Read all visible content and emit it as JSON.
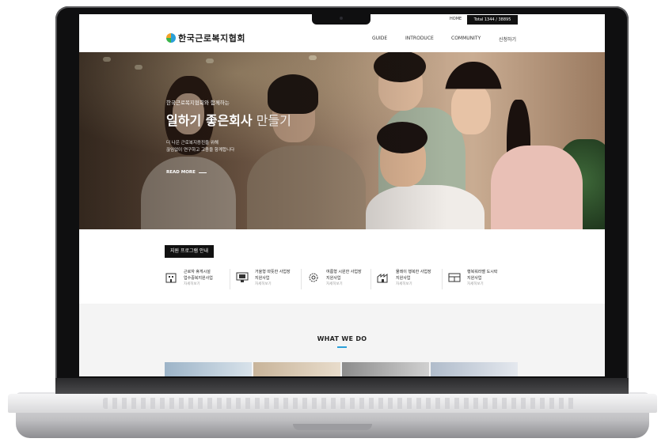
{
  "topbar": {
    "home": "HOME",
    "total": "Total 1344 / 38895"
  },
  "header": {
    "logo_text": "한국근로복지협회",
    "nav": [
      "GUIDE",
      "INTRODUCE",
      "COMMUNITY",
      "신청하기"
    ]
  },
  "hero": {
    "subtitle": "한국근로복지협회와 함께하는",
    "title_bold": "일하기 좋은회사",
    "title_light": " 만들기",
    "desc_line1": "더 나은 근로복지증진을 위해",
    "desc_line2": "끊임없이 연구하고 고충을 함께합니다",
    "more": "READ MORE"
  },
  "program": {
    "button": "지원 프로그램 안내",
    "items": [
      {
        "line1": "근로자 휴게시설",
        "line2": "업수중복지원사업",
        "link": "자세히보기",
        "icon": "building-icon"
      },
      {
        "line1": "거울형 따뜻한 사업장",
        "line2": "지원사업",
        "link": "자세히보기",
        "icon": "monitor-icon"
      },
      {
        "line1": "여름형 시원한 사업장",
        "line2": "지원사업",
        "link": "자세히보기",
        "icon": "gear-icon"
      },
      {
        "line1": "물레이 행복한 사업장",
        "line2": "지원사업",
        "link": "자세히보기",
        "icon": "factory-icon"
      },
      {
        "line1": "행복워라벨 도시락",
        "line2": "지원사업",
        "link": "자세히보기",
        "icon": "lunchbox-icon"
      }
    ]
  },
  "section": {
    "what_we_do": "WHAT WE DO"
  },
  "colors": {
    "accent": "#2a9fd8",
    "dark": "#111111"
  }
}
